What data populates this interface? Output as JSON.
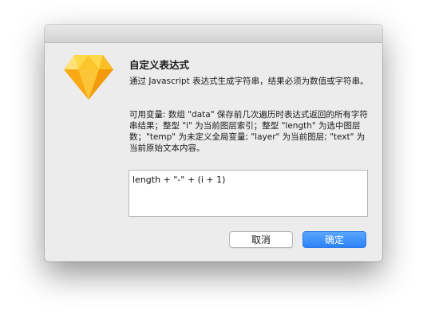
{
  "dialog": {
    "title": "自定义表达式",
    "description": "通过 Javascript 表达式生成字符串，结果必须为数值或字符串。",
    "variables_help": "可用变量: 数组 \"data\" 保存前几次遍历时表达式返回的所有字符串结果；整型 \"i\" 为当前图层索引；整型 \"length\" 为选中图层数；\"temp\" 为未定义全局变量; \"layer\" 为当前图层; \"text\" 为当前原始文本内容。",
    "expression_value": "length + \"-\" + (i + 1)",
    "cancel_label": "取消",
    "ok_label": "确定"
  },
  "icons": {
    "app_icon": "sketch-diamond-icon"
  },
  "colors": {
    "accent": "#2a83f6",
    "gem_light": "#fdd231",
    "gem_dark": "#f7a20f"
  }
}
